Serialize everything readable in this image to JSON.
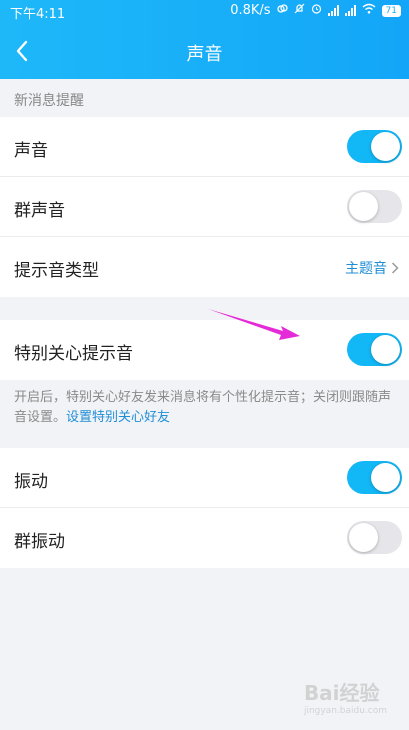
{
  "status_bar": {
    "time": "下午4:11",
    "net_speed": "0.8K/s",
    "battery": "71"
  },
  "nav": {
    "title": "声音",
    "back_icon": "chevron-left-icon"
  },
  "sections": {
    "new_message_header": "新消息提醒"
  },
  "settings": {
    "sound": {
      "label": "声音",
      "on": true
    },
    "group_sound": {
      "label": "群声音",
      "on": false
    },
    "tone_type": {
      "label": "提示音类型",
      "value": "主题音"
    },
    "special_care_tone": {
      "label": "特别关心提示音",
      "on": true
    },
    "special_care_desc": "开启后，特别关心好友发来消息将有个性化提示音；关闭则跟随声音设置。",
    "special_care_link": "设置特别关心好友",
    "vibrate": {
      "label": "振动",
      "on": true
    },
    "group_vibrate": {
      "label": "群振动",
      "on": false
    }
  },
  "colors": {
    "accent": "#12b7f5",
    "toggle_off": "#e5e5ea",
    "annotation_arrow": "#e52ad8"
  },
  "watermark": {
    "main": "Bai经验",
    "sub": "jingyan.baidu.com"
  }
}
